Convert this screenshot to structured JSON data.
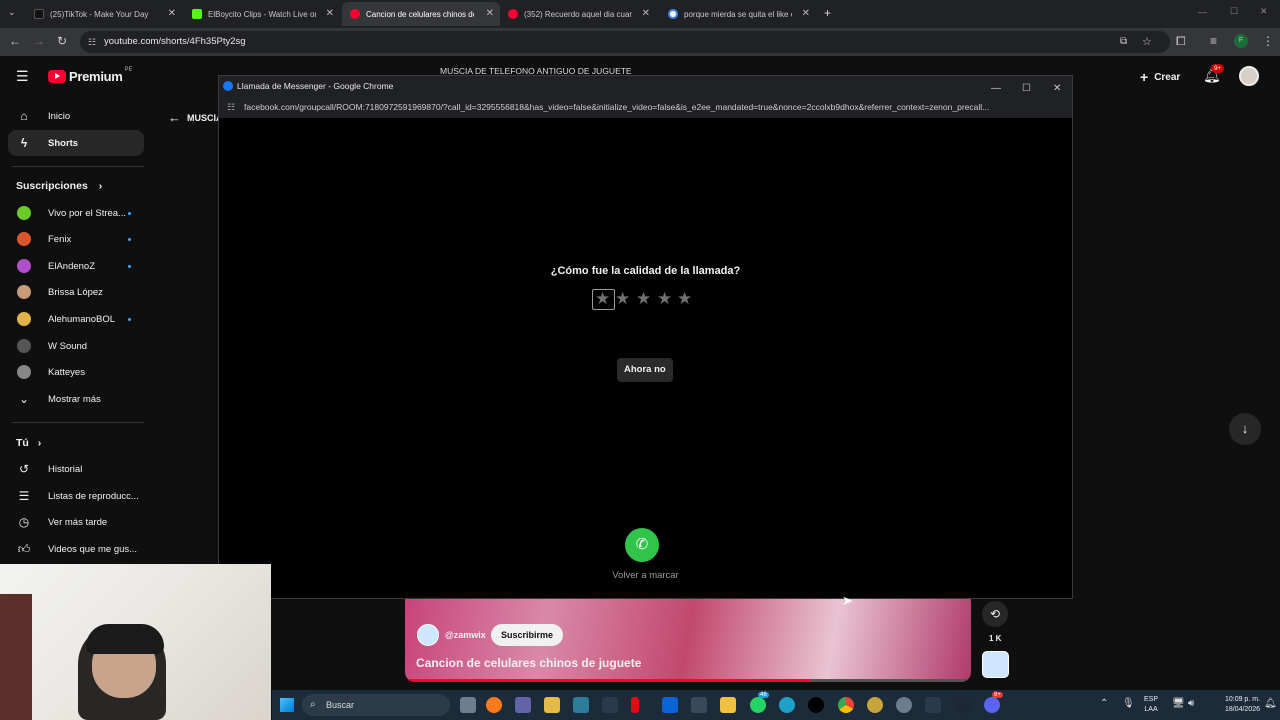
{
  "browser": {
    "tabs": [
      {
        "title": "(25)TikTok - Make Your Day",
        "color": "#111111"
      },
      {
        "title": "ElBoycito Clips - Watch Live on",
        "color": "#53fc18"
      },
      {
        "title": "Cancion de celulares chinos de",
        "color": "#ff0033"
      },
      {
        "title": "(352) Recuerdo aquel dia cuand",
        "color": "#ff0033"
      },
      {
        "title": "porque mierda se quita el like e",
        "color": "#4285f4"
      }
    ],
    "url": "youtube.com/shorts/4Fh35Pty2sg",
    "profile_initial": "F"
  },
  "youtube": {
    "logo": "Premium",
    "logo_region": "PE",
    "search_value": "MUSCIA DE TELEFONO ANTIGUO DE JUGUETE",
    "create_label": "Crear",
    "notif_count": "9+",
    "back_label": "MUSCIA",
    "sidebar": {
      "main": [
        {
          "label": "Inicio",
          "icon": "home-icon"
        },
        {
          "label": "Shorts",
          "icon": "shorts-icon"
        }
      ],
      "subs_header": "Suscripciones",
      "subs": [
        {
          "label": "Vivo por el Strea...",
          "dot": true,
          "color": "#6ccb2b"
        },
        {
          "label": "Fenix",
          "dot": true,
          "color": "#d9552b"
        },
        {
          "label": "ElAndenoZ",
          "dot": true,
          "color": "#b04fc9"
        },
        {
          "label": "Brissa López",
          "dot": false,
          "color": "#c99a7a"
        },
        {
          "label": "AlehumanoBOL",
          "dot": true,
          "color": "#e0b34a"
        },
        {
          "label": "W Sound",
          "dot": false,
          "color": "#555555"
        },
        {
          "label": "Katteyes",
          "dot": false,
          "color": "#888888"
        }
      ],
      "more": "Mostrar más",
      "you_header": "Tú",
      "you": [
        {
          "label": "Historial",
          "icon": "history-icon"
        },
        {
          "label": "Listas de reproducc...",
          "icon": "playlist-icon"
        },
        {
          "label": "Ver más tarde",
          "icon": "clock-icon"
        },
        {
          "label": "Videos que me gus...",
          "icon": "thumbs-up-icon"
        }
      ]
    },
    "short": {
      "channel": "@zamwix",
      "subscribe": "Suscribirme",
      "title": "Cancion de celulares chinos de juguete",
      "remix_count": "1 K"
    }
  },
  "popup": {
    "window_title": "Llamada de Messenger - Google Chrome",
    "url": "facebook.com/groupcall/ROOM:7180972591969870/?call_id=3295556818&has_video=false&initialize_video=false&is_e2ee_mandated=true&nonce=2ccolxb9dhox&referrer_context=zenon_precall...",
    "question": "¿Cómo fue la calidad de la llamada?",
    "rating_max": 5,
    "rating_value": 0,
    "not_now": "Ahora no",
    "redial": "Volver a marcar",
    "redial_color": "#31c44a"
  },
  "taskbar": {
    "search_placeholder": "Buscar",
    "lang": "ESP",
    "lang2": "LAA",
    "time": "10:09 p. m.",
    "date": "18/04/2026",
    "whatsapp_badge": "46",
    "discord_badge": "9+"
  }
}
